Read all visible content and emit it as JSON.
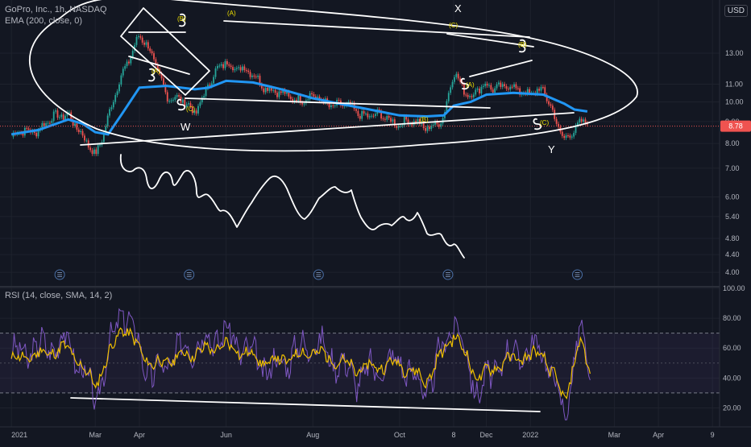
{
  "header": {
    "symbol_title": "GoPro, Inc., 1h, NASDAQ",
    "ema_label": "EMA (200, close, 0)",
    "currency": "USD"
  },
  "indicator": {
    "rsi_label": "RSI (14, close, SMA, 14, 2)"
  },
  "price_label": "8.78",
  "colors": {
    "background": "#131722",
    "ema": "#2196f3",
    "rsi_line": "#7e57c2",
    "rsi_ma": "#f0c000",
    "up": "#26a69a",
    "down": "#ef5350",
    "drawing": "#ffffff",
    "wave_label": "#f0e100"
  },
  "chart_data": [
    {
      "type": "line",
      "subtype": "candlestick",
      "title": "GoPro, Inc., 1h, NASDAQ",
      "y_scale": "log",
      "ylim": [
        3.8,
        17
      ],
      "y_ticks": [
        "13.00",
        "11.00",
        "10.00",
        "9.00",
        "8.00",
        "7.00",
        "6.00",
        "5.40",
        "4.80",
        "4.40",
        "4.00"
      ],
      "y_tick_values": [
        13,
        11,
        10,
        9,
        8,
        7,
        6,
        5.4,
        4.8,
        4.4,
        4
      ],
      "x_ticks": [
        "2021",
        "Mar",
        "Apr",
        "Jun",
        "Aug",
        "Oct",
        "8",
        "Dec",
        "2022",
        "Mar",
        "Apr",
        "9"
      ],
      "x": [
        "2021-01-01",
        "2021-01-20",
        "2021-02-10",
        "2021-02-20",
        "2021-03-01",
        "2021-03-10",
        "2021-03-20",
        "2021-04-01",
        "2021-04-20",
        "2021-05-10",
        "2021-05-20",
        "2021-06-01",
        "2021-06-20",
        "2021-07-10",
        "2021-08-01",
        "2021-08-20",
        "2021-09-10",
        "2021-10-01",
        "2021-10-20",
        "2021-11-01",
        "2021-11-08",
        "2021-11-20",
        "2021-12-01",
        "2021-12-20",
        "2022-01-10",
        "2022-01-25",
        "2022-02-01",
        "2022-02-10"
      ],
      "series": [
        {
          "name": "",
          "values": [
            8.3,
            8.7,
            9.5,
            8.2,
            7.5,
            9.2,
            11.5,
            14.5,
            10.5,
            9.5,
            11,
            12.5,
            11.5,
            10.3,
            10.2,
            9.8,
            9.3,
            9.0,
            8.8,
            9.0,
            11.8,
            10.2,
            11,
            10.7,
            10.5,
            8.2,
            8.5,
            9.2
          ]
        },
        {
          "name": "EMA (200, close, 0)",
          "values": [
            8.4,
            8.6,
            9.1,
            8.9,
            8.5,
            8.4,
            9.4,
            10.8,
            10.9,
            10.7,
            10.8,
            11.2,
            11.1,
            10.7,
            10.2,
            9.9,
            9.6,
            9.3,
            9.25,
            9.3,
            9.8,
            10.0,
            10.4,
            10.5,
            10.4,
            9.9,
            9.6,
            9.5
          ]
        }
      ],
      "annotations": [
        "(A)",
        "(B)",
        "(C)",
        "(C)",
        "(A)",
        "(B)",
        "(C)",
        "W",
        "X",
        "Y",
        "(A)",
        "(C)"
      ],
      "last_price": 8.78
    },
    {
      "type": "line",
      "title": "RSI (14, close, SMA, 14, 2)",
      "ylim": [
        10,
        100
      ],
      "y_ticks": [
        "100.00",
        "80.00",
        "60.00",
        "40.00",
        "20.00"
      ],
      "y_tick_values": [
        100,
        80,
        60,
        40,
        20
      ],
      "bands": {
        "upper": 70,
        "middle": 50,
        "lower": 30
      },
      "x": [
        "2021-01-01",
        "2021-02-10",
        "2021-03-01",
        "2021-03-20",
        "2021-04-10",
        "2021-05-01",
        "2021-06-01",
        "2021-07-01",
        "2021-08-01",
        "2021-09-01",
        "2021-10-01",
        "2021-10-20",
        "2021-11-08",
        "2021-11-25",
        "2021-12-15",
        "2022-01-10",
        "2022-01-25",
        "2022-02-05",
        "2022-02-12"
      ],
      "series": [
        {
          "name": "RSI",
          "values": [
            55,
            65,
            25,
            88,
            40,
            60,
            70,
            45,
            65,
            40,
            52,
            30,
            80,
            30,
            55,
            60,
            15,
            72,
            40
          ]
        },
        {
          "name": "RSI-based MA",
          "values": [
            52,
            60,
            35,
            75,
            48,
            55,
            62,
            50,
            58,
            46,
            50,
            38,
            70,
            40,
            52,
            56,
            25,
            65,
            45
          ]
        }
      ]
    }
  ]
}
